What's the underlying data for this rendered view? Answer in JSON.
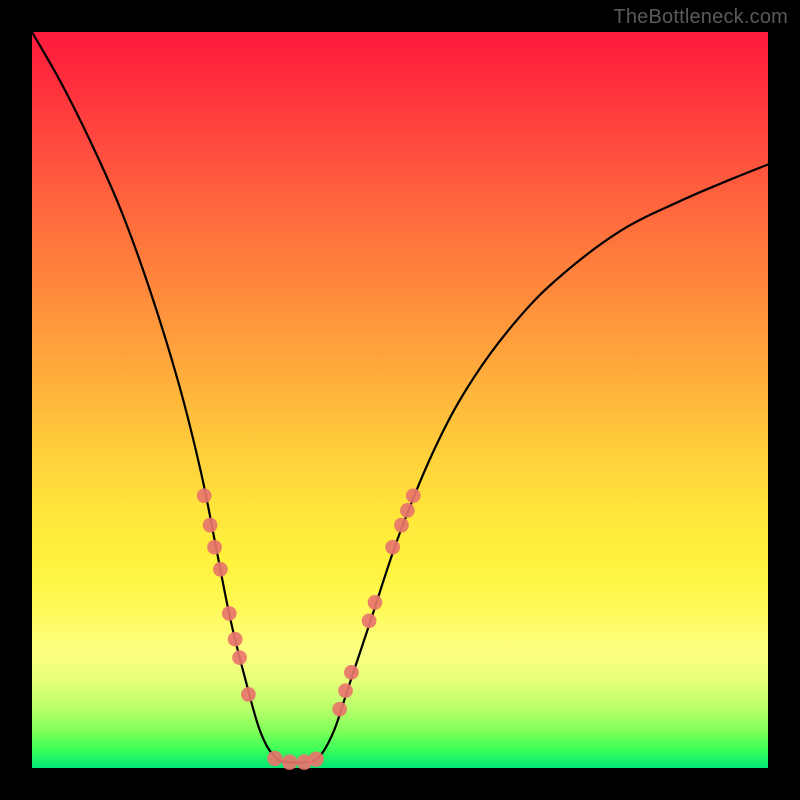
{
  "watermark": "TheBottleneck.com",
  "chart_data": {
    "type": "line",
    "title": "",
    "xlabel": "",
    "ylabel": "",
    "xlim": [
      0,
      100
    ],
    "ylim": [
      0,
      100
    ],
    "curve": [
      {
        "x": 0,
        "y": 100
      },
      {
        "x": 4,
        "y": 93
      },
      {
        "x": 8,
        "y": 85
      },
      {
        "x": 12,
        "y": 76
      },
      {
        "x": 16,
        "y": 65
      },
      {
        "x": 20,
        "y": 52
      },
      {
        "x": 23,
        "y": 40
      },
      {
        "x": 25,
        "y": 30
      },
      {
        "x": 27,
        "y": 20
      },
      {
        "x": 29,
        "y": 12
      },
      {
        "x": 31,
        "y": 5
      },
      {
        "x": 33,
        "y": 1.5
      },
      {
        "x": 35,
        "y": 0.8
      },
      {
        "x": 37,
        "y": 0.8
      },
      {
        "x": 39,
        "y": 1.5
      },
      {
        "x": 41,
        "y": 5
      },
      {
        "x": 43,
        "y": 11
      },
      {
        "x": 46,
        "y": 20
      },
      {
        "x": 50,
        "y": 32
      },
      {
        "x": 55,
        "y": 44
      },
      {
        "x": 60,
        "y": 53
      },
      {
        "x": 66,
        "y": 61
      },
      {
        "x": 72,
        "y": 67
      },
      {
        "x": 80,
        "y": 73
      },
      {
        "x": 88,
        "y": 77
      },
      {
        "x": 95,
        "y": 80
      },
      {
        "x": 100,
        "y": 82
      }
    ],
    "markers_left": [
      {
        "x": 23.4,
        "y": 37
      },
      {
        "x": 24.2,
        "y": 33
      },
      {
        "x": 24.8,
        "y": 30
      },
      {
        "x": 25.6,
        "y": 27
      },
      {
        "x": 26.8,
        "y": 21
      },
      {
        "x": 27.6,
        "y": 17.5
      },
      {
        "x": 28.2,
        "y": 15
      },
      {
        "x": 29.4,
        "y": 10
      }
    ],
    "markers_right": [
      {
        "x": 41.8,
        "y": 8
      },
      {
        "x": 42.6,
        "y": 10.5
      },
      {
        "x": 43.4,
        "y": 13
      },
      {
        "x": 45.8,
        "y": 20
      },
      {
        "x": 46.6,
        "y": 22.5
      },
      {
        "x": 49.0,
        "y": 30
      },
      {
        "x": 50.2,
        "y": 33
      },
      {
        "x": 51.0,
        "y": 35
      },
      {
        "x": 51.8,
        "y": 37
      }
    ],
    "markers_bottom": [
      {
        "x": 33.0,
        "y": 1.3
      },
      {
        "x": 35.0,
        "y": 0.8
      },
      {
        "x": 37.0,
        "y": 0.8
      },
      {
        "x": 38.6,
        "y": 1.2
      }
    ],
    "marker_color": "#e8756b",
    "marker_radius_pct": 1.0,
    "gradient_stops": [
      {
        "pos": 0.0,
        "color": "#ff1a3c"
      },
      {
        "pos": 0.3,
        "color": "#ff7a3c"
      },
      {
        "pos": 0.6,
        "color": "#ffe83b"
      },
      {
        "pos": 0.88,
        "color": "#b8ff6a"
      },
      {
        "pos": 1.0,
        "color": "#00e676"
      }
    ]
  }
}
